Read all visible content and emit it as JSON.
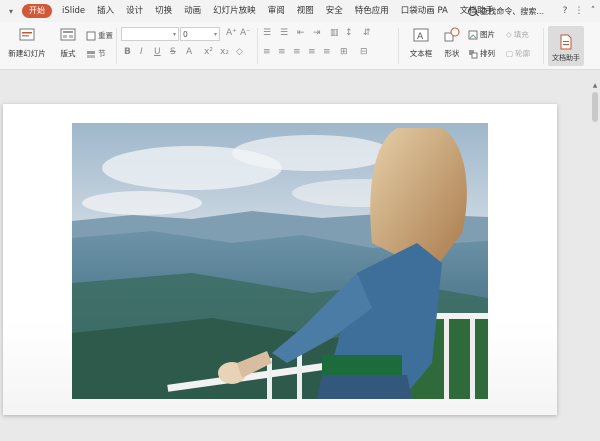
{
  "tabs": {
    "menu_icon": "menu-chevron-icon",
    "items": [
      {
        "label": "开始",
        "active": true
      },
      {
        "label": "iSlide"
      },
      {
        "label": "插入"
      },
      {
        "label": "设计"
      },
      {
        "label": "切换"
      },
      {
        "label": "动画"
      },
      {
        "label": "幻灯片放映"
      },
      {
        "label": "审阅"
      },
      {
        "label": "视图"
      },
      {
        "label": "安全"
      },
      {
        "label": "特色应用"
      },
      {
        "label": "口袋动画 PA"
      },
      {
        "label": "文档助手"
      }
    ],
    "search_label": "查找命令、搜索...",
    "right_icons": [
      "help-icon",
      "more-icon",
      "collapse-icon"
    ]
  },
  "ribbon": {
    "new_slide": "新建幻灯片",
    "layout": "版式",
    "reset": "重置",
    "section": "节",
    "font_value": "",
    "size_value": "0",
    "textbox": "文本框",
    "shapes": "形状",
    "picture": "图片",
    "fill": "填充",
    "arrange": "排列",
    "outline": "轮廓",
    "doc_assistant": "文档助手"
  },
  "colors": {
    "active_tab": "#d0593a",
    "workspace": "#e9e9e9",
    "ribbon": "#f7f7f7"
  }
}
